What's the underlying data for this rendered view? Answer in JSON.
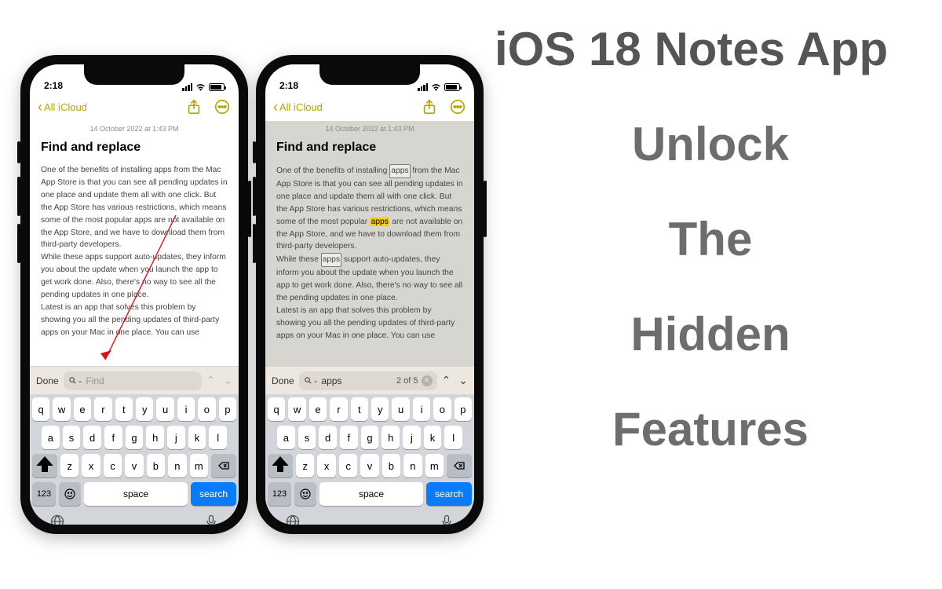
{
  "headline": {
    "line1": "iOS 18 Notes App",
    "w1": "Unlock",
    "w2": "The",
    "w3": "Hidden",
    "w4": "Features"
  },
  "status": {
    "time": "2:18"
  },
  "nav": {
    "back_label": "All iCloud"
  },
  "note": {
    "date": "14 October 2022 at 1:43 PM",
    "title": "Find and replace",
    "p1a": "One of the benefits of installing ",
    "p1_apps": "apps",
    "p1b": " from the Mac App Store is that you can see all pending updates in one place and update them all with one click. But the App Store has various restrictions, which means some of the most popular ",
    "p1_apps2": "apps",
    "p1c": " are not available on the App Store, and we have to download them from third-party developers.",
    "p2a": "While these ",
    "p2_apps": "apps",
    "p2b": " support auto-updates, they inform you about the update when you launch the app to get work done. Also, there's no way to see all the pending updates in one place.",
    "p3": "Latest is an app that solves this problem by showing you all the pending updates of third-party apps on your Mac in one place. You can use"
  },
  "find": {
    "done": "Done",
    "placeholder": "Find",
    "value_phone2": "apps",
    "counter": "2 of 5"
  },
  "keyboard": {
    "row1": [
      "q",
      "w",
      "e",
      "r",
      "t",
      "y",
      "u",
      "i",
      "o",
      "p"
    ],
    "row2": [
      "a",
      "s",
      "d",
      "f",
      "g",
      "h",
      "j",
      "k",
      "l"
    ],
    "row3": [
      "z",
      "x",
      "c",
      "v",
      "b",
      "n",
      "m"
    ],
    "k123": "123",
    "space": "space",
    "search": "search"
  }
}
